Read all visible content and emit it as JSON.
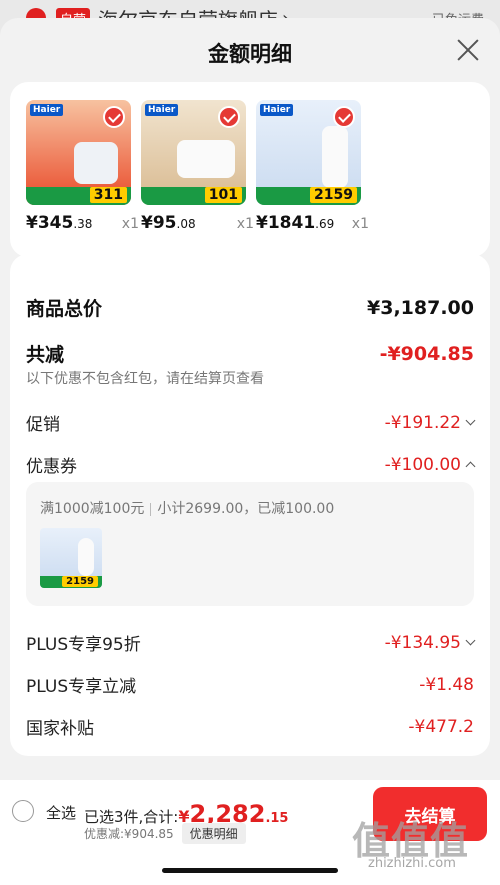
{
  "underlay": {
    "badge": "自营",
    "shop_name": "海尔京东自营旗舰店",
    "chevron": "›",
    "shipping": "已免运费"
  },
  "sheet": {
    "title": "金额明细"
  },
  "products": [
    {
      "brand": "Haier",
      "price_int": "¥345",
      "price_dec": ".38",
      "qty": "x1",
      "tag": "311",
      "theme": "#e94a2a"
    },
    {
      "brand": "Haier",
      "price_int": "¥95",
      "price_dec": ".08",
      "qty": "x1",
      "tag": "101",
      "theme": "#ffd24a"
    },
    {
      "brand": "Haier",
      "price_int": "¥1841",
      "price_dec": ".69",
      "qty": "x1",
      "tag": "2159",
      "theme": "#dfe9f5"
    }
  ],
  "details": {
    "total_label": "商品总价",
    "total_value": "¥3,187.00",
    "reduce_label": "共减",
    "reduce_value": "-¥904.85",
    "note": "以下优惠不包含红包，请在结算页查看",
    "promo_label": "促销",
    "promo_value": "-¥191.22",
    "coupon_label": "优惠券",
    "coupon_value": "-¥100.00",
    "coupon_rule": "满1000减100元",
    "coupon_subtotal": "小计2699.00，已减100.00",
    "coupon_thumb_tag": "2159",
    "plus95_label": "PLUS专享95折",
    "plus95_value": "-¥134.95",
    "plus_direct_label": "PLUS专享立减",
    "plus_direct_value": "-¥1.48",
    "subsidy_label": "国家补贴",
    "subsidy_value": "-¥477.2"
  },
  "bottom": {
    "select_all": "全选",
    "selected": "已选3件,合计:",
    "total_currency": "¥",
    "total_int": "2,282",
    "total_dec": ".15",
    "discount": "优惠减:¥904.85",
    "detail_chip": "优惠明细",
    "checkout": "去结算",
    "watermark": "值值值",
    "watermark_url": "zhizhizhi.com"
  }
}
